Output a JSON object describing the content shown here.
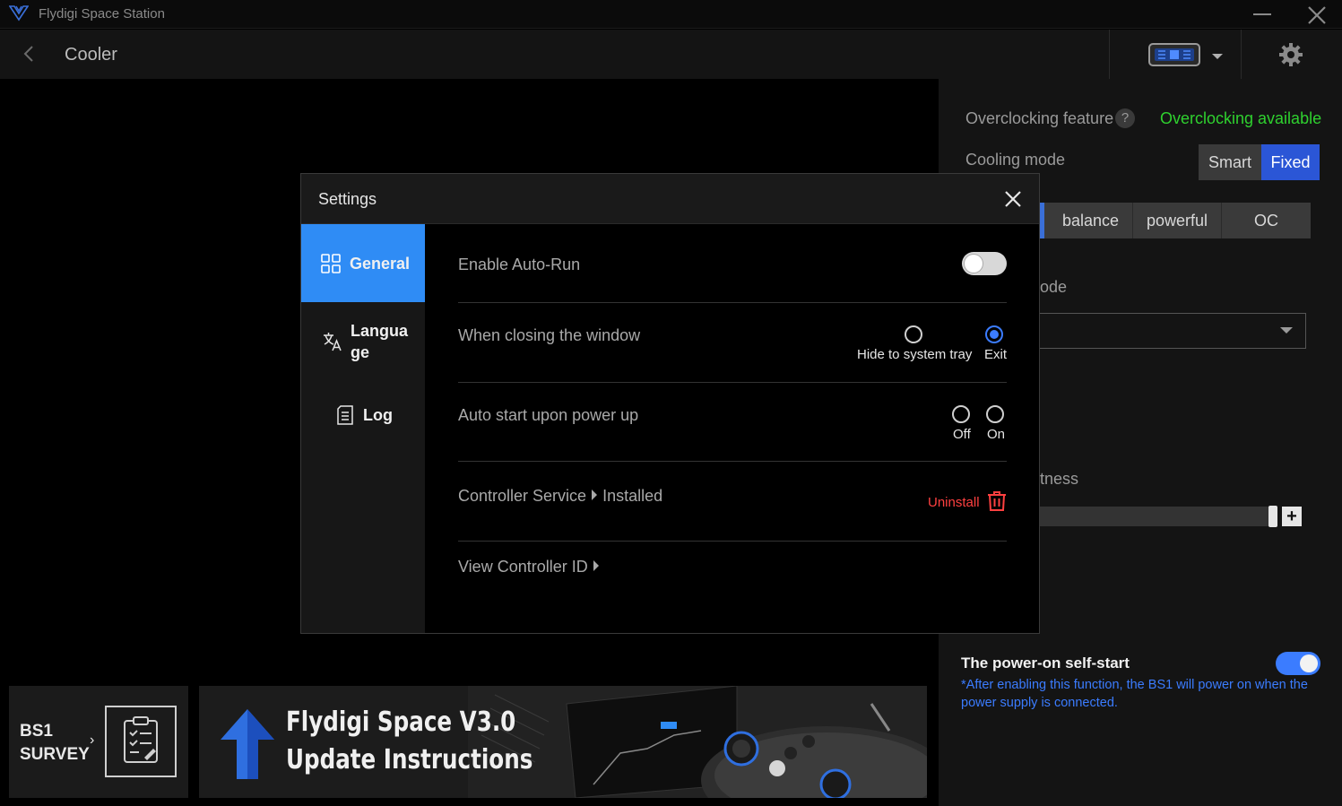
{
  "app": {
    "title": "Flydigi Space Station"
  },
  "header": {
    "page_title": "Cooler"
  },
  "right_panel": {
    "overclocking_label": "Overclocking feature",
    "help_glyph": "?",
    "overclocking_status": "Overclocking available",
    "cooling_mode_label": "Cooling mode",
    "cooling_modes": [
      "Smart",
      "Fixed"
    ],
    "cooling_mode_selected": "Fixed",
    "fan_modes": [
      "balance",
      "powerful",
      "OC"
    ],
    "partial_mode_label": "ode",
    "partial_brightness_label": "tness",
    "plus_glyph": "+",
    "selfstart_title": "The power-on self-start",
    "selfstart_desc": "*After enabling this function, the BS1 will power on when the power supply is connected.",
    "selfstart_enabled": true
  },
  "banners": {
    "survey_line1": "BS1",
    "survey_line2": "SURVEY",
    "update_line1": "Flydigi Space V3.0",
    "update_line2": "Update Instructions"
  },
  "settings_modal": {
    "title": "Settings",
    "sidebar": {
      "general": "General",
      "language_line1": "Langua",
      "language_line2": "ge",
      "log": "Log"
    },
    "auto_run_label": "Enable Auto-Run",
    "auto_run_enabled": false,
    "closing_label": "When closing the window",
    "closing_options": [
      "Hide to system tray",
      "Exit"
    ],
    "closing_selected": "Exit",
    "power_up_label": "Auto start upon power up",
    "power_up_options": [
      "Off",
      "On"
    ],
    "controller_service_label": "Controller Service",
    "controller_service_status": "Installed",
    "uninstall_label": "Uninstall",
    "view_id_label": "View Controller ID"
  },
  "colors": {
    "accent_blue": "#2f8cf5",
    "fixed_blue": "#2b56d6",
    "status_green": "#2fd12f",
    "danger_red": "#ff4040"
  }
}
